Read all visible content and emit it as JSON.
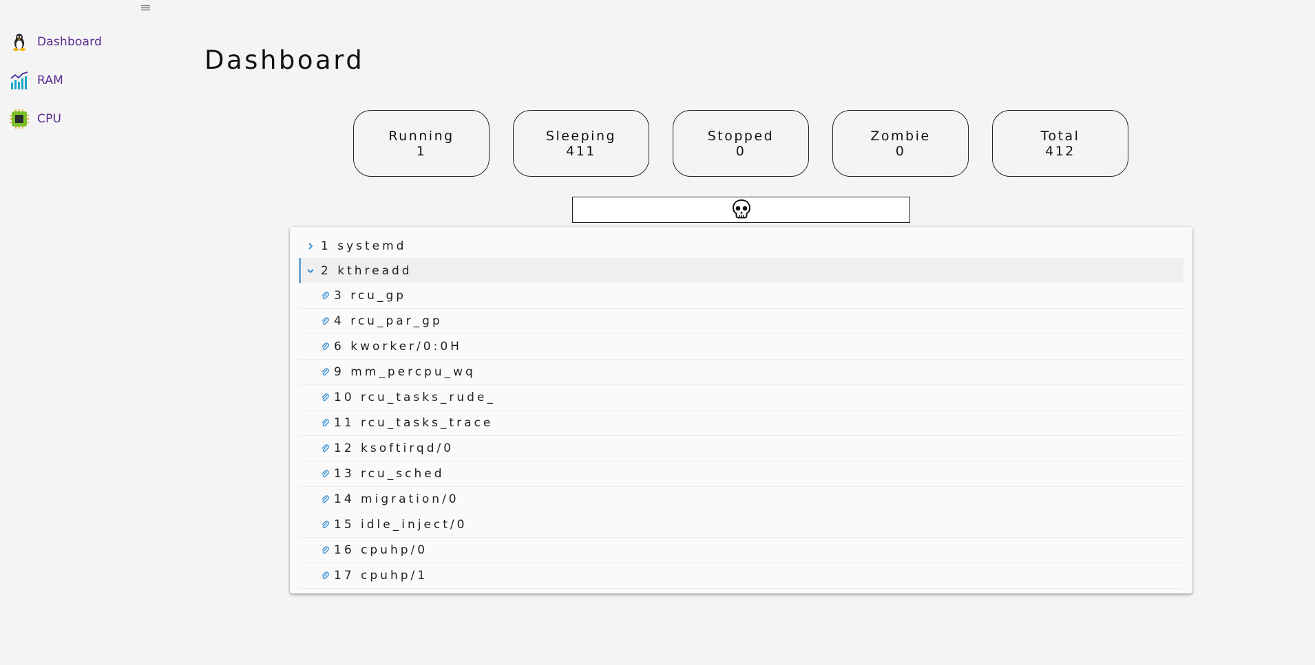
{
  "sidebar": {
    "items": [
      {
        "label": "Dashboard",
        "icon": "linux-penguin-icon"
      },
      {
        "label": "RAM",
        "icon": "line-bar-chart-icon"
      },
      {
        "label": "CPU",
        "icon": "chip-icon"
      }
    ]
  },
  "page": {
    "title": "Dashboard"
  },
  "stats": [
    {
      "label": "Running",
      "value": "1"
    },
    {
      "label": "Sleeping",
      "value": "411"
    },
    {
      "label": "Stopped",
      "value": "0"
    },
    {
      "label": "Zombie",
      "value": "0"
    },
    {
      "label": "Total",
      "value": "412"
    }
  ],
  "kill_button": {
    "icon": "skull-icon"
  },
  "process_tree": {
    "roots": [
      {
        "text": "1 systemd",
        "expanded": false
      },
      {
        "text": "2 kthreadd",
        "expanded": true,
        "selected": true
      }
    ],
    "children": [
      "3 rcu_gp",
      "4 rcu_par_gp",
      "6 kworker/0:0H",
      "9 mm_percpu_wq",
      "10 rcu_tasks_rude_",
      "11 rcu_tasks_trace",
      "12 ksoftirqd/0",
      "13 rcu_sched",
      "14 migration/0",
      "15 idle_inject/0",
      "16 cpuhp/0",
      "17 cpuhp/1"
    ]
  },
  "colors": {
    "nav_text": "#5a2a91",
    "selection_accent": "#6ba7d8",
    "background": "#f4f4f4"
  }
}
